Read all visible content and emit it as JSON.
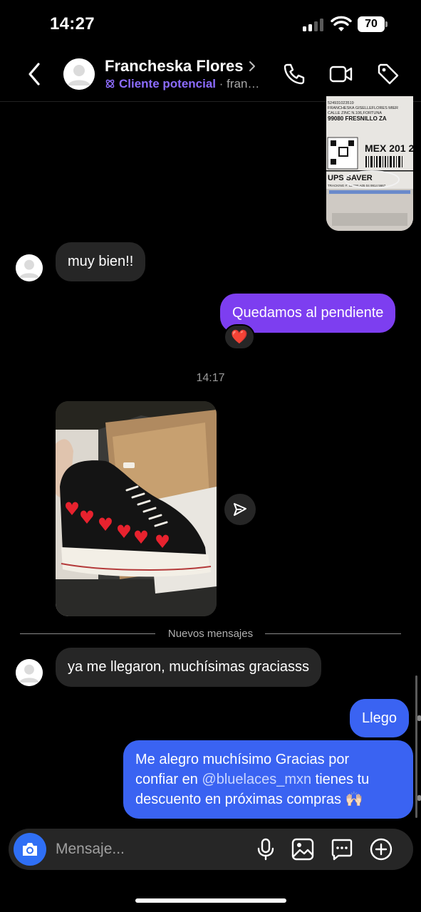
{
  "status_bar": {
    "time": "14:27",
    "battery": "70"
  },
  "header": {
    "contact_name": "Francheska Flores",
    "lead_label": "Cliente potencial",
    "sub_extra": " · fran…"
  },
  "messages": {
    "shipping_label_lines": [
      "FRANCHESKA GISELLEFLORES MIER",
      "CALLE ZINC N.106,FORTUNA",
      "99080  FRESNILLO  ZA",
      "MEX 201 2",
      "UPS SAVER"
    ],
    "incoming_1": "muy bien!!",
    "outgoing_1": "Quedamos al pendiente",
    "reaction_1": "❤️",
    "time_separator": "14:17",
    "new_messages_label": "Nuevos mensajes",
    "incoming_2": "ya me llegaron, muchísimas graciasss",
    "outgoing_2": "Llego",
    "outgoing_3_line1": "Me alegro muchísimo Gracias por",
    "outgoing_3_line2_pre": "confiar en ",
    "outgoing_3_mention": "@bluelaces_mxn",
    "outgoing_3_line2_post": " tienes tu",
    "outgoing_3_line3": "descuento en próximas compras 🙌🏻"
  },
  "composer": {
    "placeholder": "Mensaje..."
  },
  "colors": {
    "purple_bubble": "#7d3ef0",
    "blue_bubble": "#3a63f2",
    "lead_purple": "#8c6cff",
    "camera_blue": "#2f6ff5"
  }
}
